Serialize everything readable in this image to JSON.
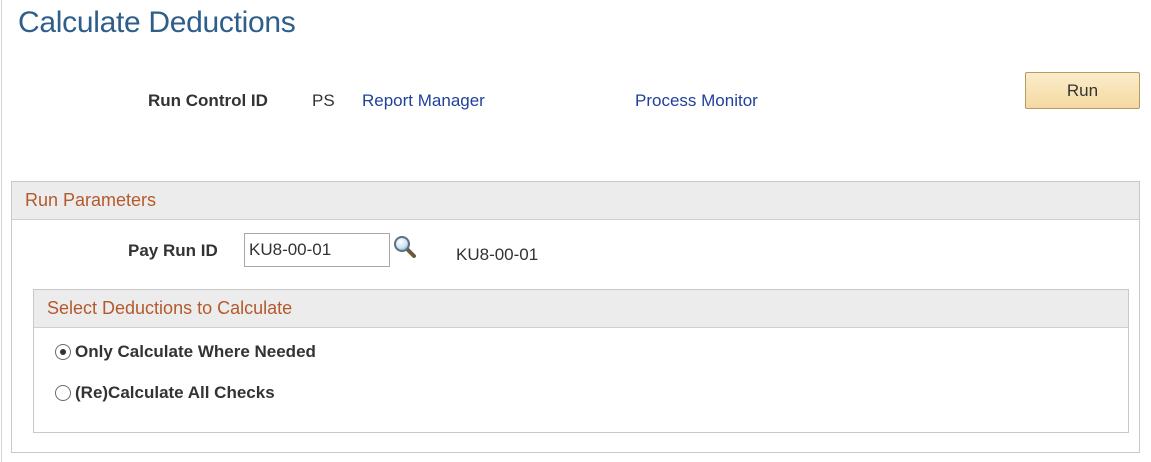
{
  "page": {
    "title": "Calculate Deductions"
  },
  "run_control": {
    "label": "Run Control ID",
    "value": "PS"
  },
  "links": {
    "report_manager": "Report Manager",
    "process_monitor": "Process Monitor"
  },
  "toolbar": {
    "run_label": "Run"
  },
  "run_parameters": {
    "header": "Run Parameters",
    "pay_run_id_label": "Pay Run ID",
    "pay_run_id_value": "KU8-00-01",
    "pay_run_id_description": "KU8-00-01",
    "lookup_icon": "magnifying-glass-icon"
  },
  "select_deductions": {
    "header": "Select Deductions to Calculate",
    "options": [
      {
        "label": "Only Calculate Where Needed",
        "selected": true
      },
      {
        "label": "(Re)Calculate All Checks",
        "selected": false
      }
    ]
  },
  "colors": {
    "title": "#2e5e8a",
    "link": "#21409a",
    "group_header_text": "#b35a2c",
    "button_fill": "#f4d9a1"
  }
}
